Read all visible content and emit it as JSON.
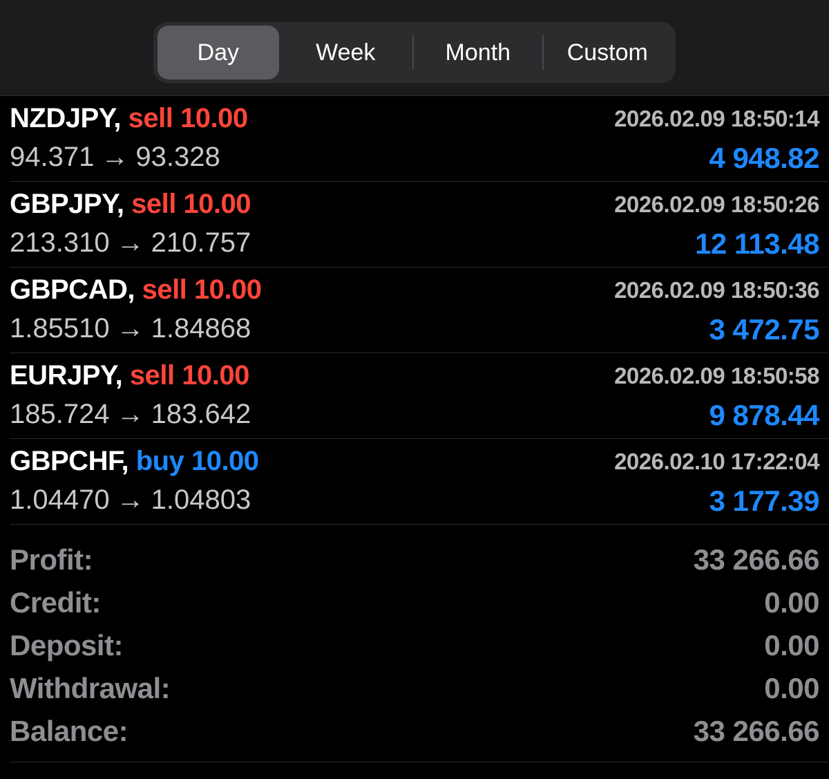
{
  "tabs": [
    {
      "label": "Day",
      "active": true
    },
    {
      "label": "Week",
      "active": false
    },
    {
      "label": "Month",
      "active": false
    },
    {
      "label": "Custom",
      "active": false
    }
  ],
  "deals": [
    {
      "symbol": "NZDJPY,",
      "side": "sell",
      "volume": "10.00",
      "time": "2026.02.09 18:50:14",
      "open_price": "94.371",
      "close_price": "93.328",
      "profit": "4 948.82"
    },
    {
      "symbol": "GBPJPY,",
      "side": "sell",
      "volume": "10.00",
      "time": "2026.02.09 18:50:26",
      "open_price": "213.310",
      "close_price": "210.757",
      "profit": "12 113.48"
    },
    {
      "symbol": "GBPCAD,",
      "side": "sell",
      "volume": "10.00",
      "time": "2026.02.09 18:50:36",
      "open_price": "1.85510",
      "close_price": "1.84868",
      "profit": "3 472.75"
    },
    {
      "symbol": "EURJPY,",
      "side": "sell",
      "volume": "10.00",
      "time": "2026.02.09 18:50:58",
      "open_price": "185.724",
      "close_price": "183.642",
      "profit": "9 878.44"
    },
    {
      "symbol": "GBPCHF,",
      "side": "buy",
      "volume": "10.00",
      "time": "2026.02.10 17:22:04",
      "open_price": "1.04470",
      "close_price": "1.04803",
      "profit": "3 177.39"
    }
  ],
  "arrow_glyph": "→",
  "summary": {
    "profit": {
      "label": "Profit:",
      "value": "33 266.66"
    },
    "credit": {
      "label": "Credit:",
      "value": "0.00"
    },
    "deposit": {
      "label": "Deposit:",
      "value": "0.00"
    },
    "withdrawal": {
      "label": "Withdrawal:",
      "value": "0.00"
    },
    "balance": {
      "label": "Balance:",
      "value": "33 266.66"
    }
  },
  "colors": {
    "sell": "#ff453a",
    "buy": "#1e88ff",
    "profit": "#1e88ff",
    "background": "#000000",
    "header": "#1c1c1e"
  }
}
